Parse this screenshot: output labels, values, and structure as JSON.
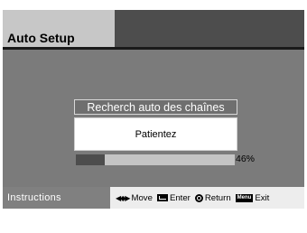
{
  "header": {
    "title": "Auto Setup"
  },
  "dialog": {
    "title": "Recherch auto des chaînes",
    "message": "Patientez"
  },
  "progress": {
    "percent": 46,
    "label": "46%"
  },
  "footer": {
    "label": "Instructions",
    "hints": [
      {
        "icon": "arrows-icon",
        "label": "Move"
      },
      {
        "icon": "enter-icon",
        "label": "Enter"
      },
      {
        "icon": "return-icon",
        "label": "Return"
      },
      {
        "icon": "menu-icon",
        "icon_text": "Menu",
        "label": "Exit"
      }
    ]
  },
  "colors": {
    "header_bg": "#4d4d4d",
    "title_tab_bg": "#c7c7c7",
    "main_bg": "#7b7b7b",
    "progress_fill": "#4d4d4d",
    "progress_track": "#c4c4c4",
    "footer_bg": "#ededed",
    "footer_label_bg": "#808080"
  }
}
